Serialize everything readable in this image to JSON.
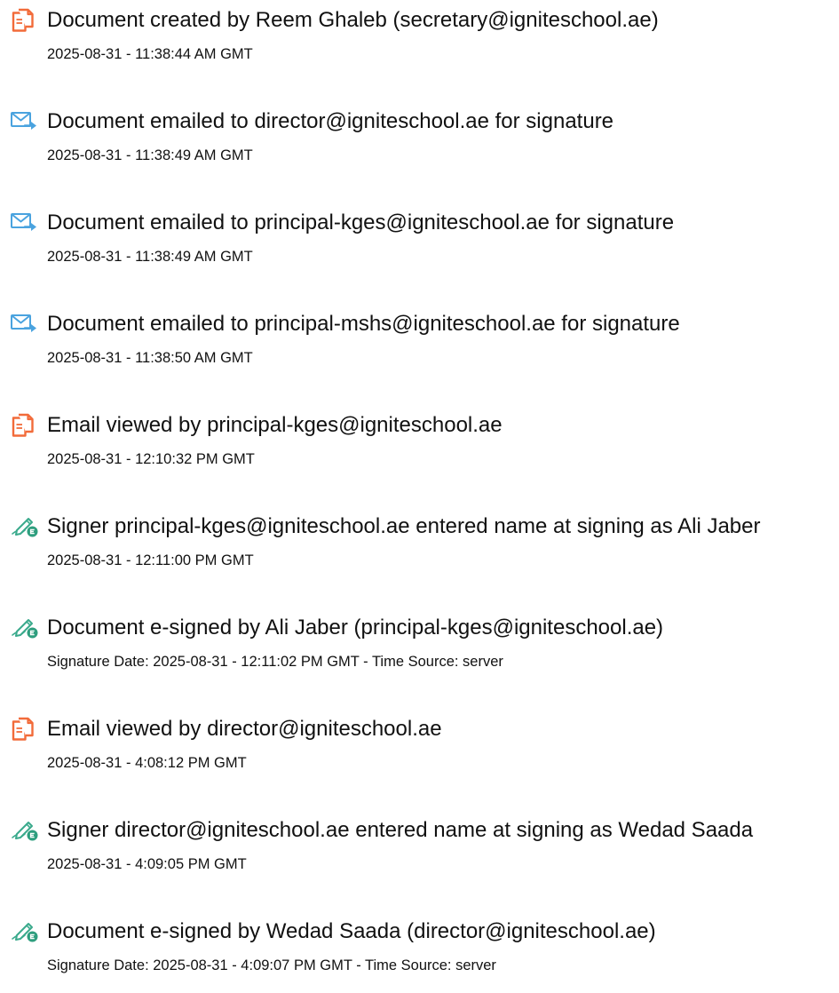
{
  "icon_colors": {
    "created": "#f26b3a",
    "emailed": "#4aa3df",
    "signed_pen": "#3aaa8c",
    "signed_badge": "#2e9e7e"
  },
  "events": [
    {
      "icon": "document-created-icon",
      "title": "Document created by Reem Ghaleb (secretary@igniteschool.ae)",
      "meta": "2025-08-31 - 11:38:44 AM GMT"
    },
    {
      "icon": "email-sent-icon",
      "title": "Document emailed to director@igniteschool.ae for signature",
      "meta": "2025-08-31 - 11:38:49 AM GMT"
    },
    {
      "icon": "email-sent-icon",
      "title": "Document emailed to principal-kges@igniteschool.ae for signature",
      "meta": "2025-08-31 - 11:38:49 AM GMT"
    },
    {
      "icon": "email-sent-icon",
      "title": "Document emailed to principal-mshs@igniteschool.ae for signature",
      "meta": "2025-08-31 - 11:38:50 AM GMT"
    },
    {
      "icon": "document-viewed-icon",
      "title": "Email viewed by principal-kges@igniteschool.ae",
      "meta": "2025-08-31 - 12:10:32 PM GMT"
    },
    {
      "icon": "e-sign-pen-icon",
      "title": "Signer principal-kges@igniteschool.ae entered name at signing as Ali Jaber",
      "meta": "2025-08-31 - 12:11:00 PM GMT"
    },
    {
      "icon": "e-sign-pen-icon",
      "title": "Document e-signed by Ali Jaber (principal-kges@igniteschool.ae)",
      "meta": "Signature Date: 2025-08-31 - 12:11:02 PM GMT - Time Source: server"
    },
    {
      "icon": "document-viewed-icon",
      "title": "Email viewed by director@igniteschool.ae",
      "meta": "2025-08-31 - 4:08:12 PM GMT"
    },
    {
      "icon": "e-sign-pen-icon",
      "title": "Signer director@igniteschool.ae entered name at signing as Wedad Saada",
      "meta": "2025-08-31 - 4:09:05 PM GMT"
    },
    {
      "icon": "e-sign-pen-icon",
      "title": "Document e-signed by Wedad Saada (director@igniteschool.ae)",
      "meta": "Signature Date: 2025-08-31 - 4:09:07 PM GMT - Time Source: server"
    }
  ]
}
